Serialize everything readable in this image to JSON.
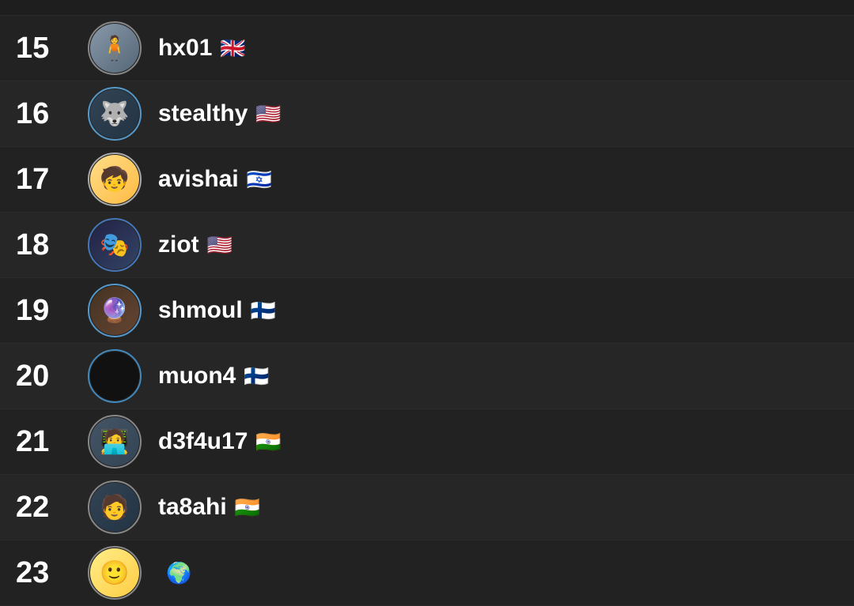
{
  "leaderboard": {
    "rows": [
      {
        "rank": "15",
        "username": "hx01",
        "flag": "🇬🇧",
        "avatarClass": "avatar-hx01",
        "avatarArt": "🧍",
        "borderColor": "#888888",
        "id": "hx01"
      },
      {
        "rank": "16",
        "username": "stealthy",
        "flag": "🇺🇸",
        "avatarClass": "avatar-stealthy",
        "avatarArt": "🐺",
        "borderColor": "#5599cc",
        "id": "stealthy"
      },
      {
        "rank": "17",
        "username": "avishai",
        "flag": "🇮🇱",
        "avatarClass": "avatar-avishai",
        "avatarArt": "🧒",
        "borderColor": "#aaaaaa",
        "id": "avishai"
      },
      {
        "rank": "18",
        "username": "ziot",
        "flag": "🇺🇸",
        "avatarClass": "avatar-ziot",
        "avatarArt": "🎭",
        "borderColor": "#4477bb",
        "id": "ziot"
      },
      {
        "rank": "19",
        "username": "shmoul",
        "flag": "🇫🇮",
        "avatarClass": "avatar-shmoul",
        "avatarArt": "🔮",
        "borderColor": "#5599cc",
        "id": "shmoul"
      },
      {
        "rank": "20",
        "username": "muon4",
        "flag": "🇫🇮",
        "avatarClass": "avatar-muon4",
        "avatarArt": "",
        "borderColor": "#4488bb",
        "id": "muon4"
      },
      {
        "rank": "21",
        "username": "d3f4u17",
        "flag": "🇮🇳",
        "avatarClass": "avatar-d3f4u17",
        "avatarArt": "🧑‍💻",
        "borderColor": "#888888",
        "id": "d3f4u17"
      },
      {
        "rank": "22",
        "username": "ta8ahi",
        "flag": "🇮🇳",
        "avatarClass": "avatar-ta8ahi",
        "avatarArt": "🧑",
        "borderColor": "#888888",
        "id": "ta8ahi"
      },
      {
        "rank": "23",
        "username": "",
        "flag": "🌍",
        "avatarClass": "avatar-row23",
        "avatarArt": "🙂",
        "borderColor": "#888888",
        "id": "row23"
      }
    ]
  }
}
